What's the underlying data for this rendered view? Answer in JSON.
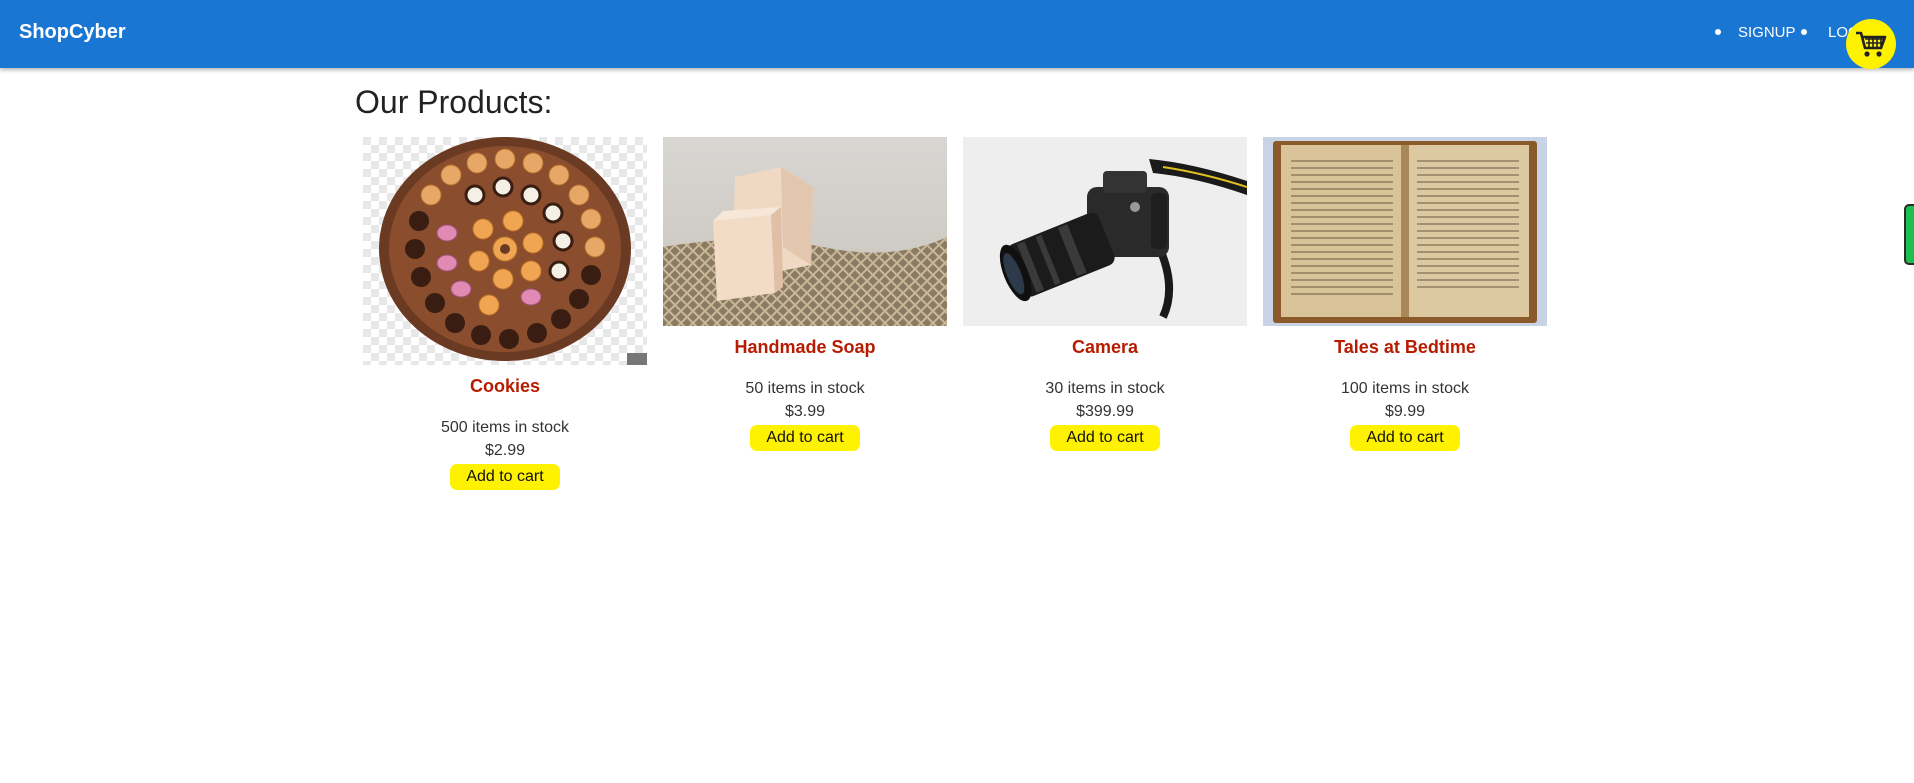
{
  "navbar": {
    "brand": "ShopCyber",
    "links": [
      "SIGNUP",
      "LOGIN"
    ],
    "cart_icon": "shopping-cart-icon",
    "background": "#1976d2",
    "cart_color": "#fff200"
  },
  "main": {
    "heading": "Our Products:",
    "products": [
      {
        "title": "Cookies",
        "stock": "500 items in stock",
        "price": "$2.99",
        "button": "Add to cart",
        "image": "cookie-platter-image"
      },
      {
        "title": "Handmade Soap",
        "stock": "50 items in stock",
        "price": "$3.99",
        "button": "Add to cart",
        "image": "soap-bars-image"
      },
      {
        "title": "Camera",
        "stock": "30 items in stock",
        "price": "$399.99",
        "button": "Add to cart",
        "image": "dslr-camera-image"
      },
      {
        "title": "Tales at Bedtime",
        "stock": "100 items in stock",
        "price": "$9.99",
        "button": "Add to cart",
        "image": "open-book-image"
      }
    ],
    "title_color": "#b71c00",
    "button_color": "#fff200"
  }
}
